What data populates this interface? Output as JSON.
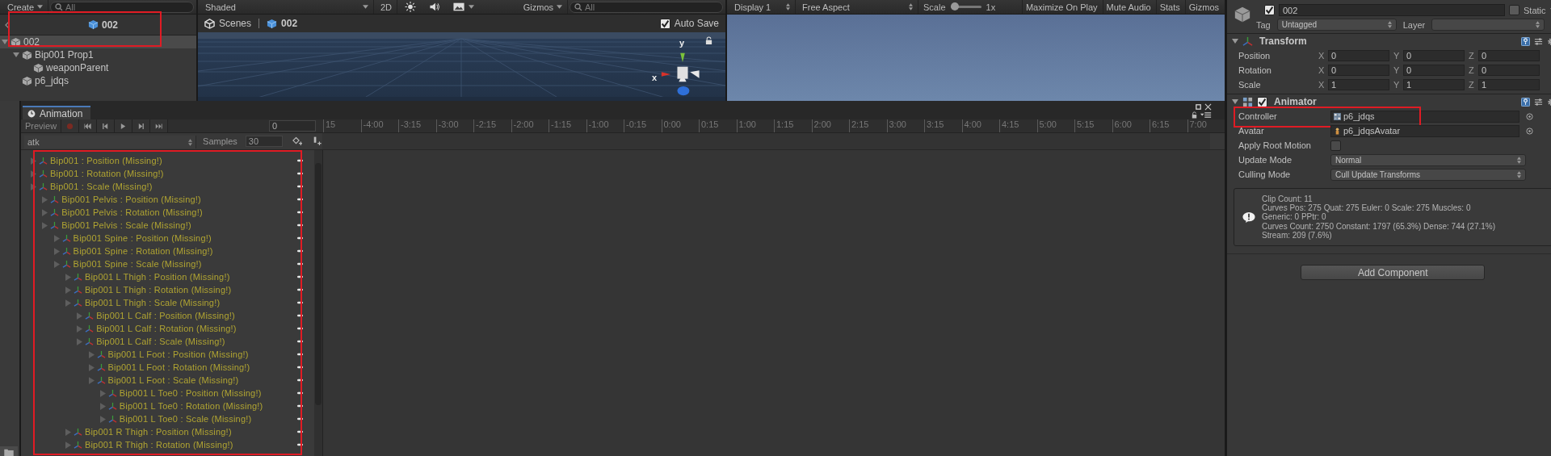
{
  "hierarchy": {
    "create": "Create",
    "search_placeholder": "All",
    "header": {
      "title": "002",
      "highlighted": true
    },
    "tree": [
      {
        "label": "002",
        "selected": true,
        "expanded": true,
        "children": [
          {
            "label": "Bip001 Prop1",
            "selected": false,
            "expanded": true,
            "children": [
              {
                "label": "weaponParent",
                "selected": false
              }
            ]
          },
          {
            "label": "p6_jdqs",
            "selected": false
          }
        ]
      }
    ]
  },
  "scene": {
    "shading": "Shaded",
    "mode_2d": "2D",
    "gizmos": "Gizmos",
    "search_placeholder": "All",
    "breadcrumb": [
      "Scenes",
      "002"
    ],
    "auto_save": {
      "label": "Auto Save",
      "checked": true
    },
    "axis_labels": [
      "y",
      "x"
    ]
  },
  "game": {
    "display": "Display 1",
    "aspect": "Free Aspect",
    "scale_label": "Scale",
    "scale": {
      "level": 0
    },
    "scale_value": "1x",
    "toggles": [
      {
        "label": "Maximize On Play",
        "on": false
      },
      {
        "label": "Mute Audio",
        "on": false
      },
      {
        "label": "Stats",
        "on": false
      },
      {
        "label": "Gizmos",
        "on": false
      }
    ]
  },
  "animation": {
    "tab": "Animation",
    "preview": "Preview",
    "recording": false,
    "frame": "0",
    "clip": "atk",
    "samples_label": "Samples",
    "samples": "30",
    "ruler": [
      "15",
      "-4:00",
      "-3:15",
      "-3:00",
      "-2:15",
      "-2:00",
      "-1:15",
      "-1:00",
      "-0:15",
      "0:00",
      "0:15",
      "1:00",
      "1:15",
      "2:00",
      "2:15",
      "3:00",
      "3:15",
      "4:00",
      "4:15",
      "5:00",
      "5:15",
      "6:00",
      "6:15",
      "7:00"
    ],
    "list_highlighted": true,
    "tracks": [
      {
        "curves": [
          "Bip001 : Position (Missing!)",
          "Bip001 : Rotation (Missing!)",
          "Bip001 : Scale (Missing!)"
        ],
        "children": [
          {
            "curves": [
              "Bip001 Pelvis : Position (Missing!)",
              "Bip001 Pelvis : Rotation (Missing!)",
              "Bip001 Pelvis : Scale (Missing!)"
            ],
            "children": [
              {
                "curves": [
                  "Bip001 Spine : Position (Missing!)",
                  "Bip001 Spine : Rotation (Missing!)",
                  "Bip001 Spine : Scale (Missing!)"
                ],
                "children": [
                  {
                    "curves": [
                      "Bip001 L Thigh : Position (Missing!)",
                      "Bip001 L Thigh : Rotation (Missing!)",
                      "Bip001 L Thigh : Scale (Missing!)"
                    ],
                    "children": [
                      {
                        "curves": [
                          "Bip001 L Calf : Position (Missing!)",
                          "Bip001 L Calf : Rotation (Missing!)",
                          "Bip001 L Calf : Scale (Missing!)"
                        ],
                        "children": [
                          {
                            "curves": [
                              "Bip001 L Foot : Position (Missing!)",
                              "Bip001 L Foot : Rotation (Missing!)",
                              "Bip001 L Foot : Scale (Missing!)"
                            ],
                            "children": [
                              {
                                "curves": [
                                  "Bip001 L Toe0 : Position (Missing!)",
                                  "Bip001 L Toe0 : Rotation (Missing!)",
                                  "Bip001 L Toe0 : Scale (Missing!)"
                                ]
                              }
                            ]
                          }
                        ]
                      }
                    ]
                  },
                  {
                    "curves": [
                      "Bip001 R Thigh : Position (Missing!)",
                      "Bip001 R Thigh : Rotation (Missing!)"
                    ]
                  }
                ]
              }
            ]
          }
        ]
      }
    ]
  },
  "inspector": {
    "object": {
      "active": true,
      "name": "002",
      "static_label": "Static",
      "static": false,
      "tag_label": "Tag",
      "tag": "Untagged",
      "layer_label": "Layer"
    },
    "transform": {
      "title": "Transform",
      "expanded": true,
      "rows": [
        {
          "label": "Position",
          "fields": [
            {
              "axis": "X",
              "value": "0"
            },
            {
              "axis": "Y",
              "value": "0"
            },
            {
              "axis": "Z",
              "value": "0"
            }
          ]
        },
        {
          "label": "Rotation",
          "fields": [
            {
              "axis": "X",
              "value": "0"
            },
            {
              "axis": "Y",
              "value": "0"
            },
            {
              "axis": "Z",
              "value": "0"
            }
          ]
        },
        {
          "label": "Scale",
          "fields": [
            {
              "axis": "X",
              "value": "1"
            },
            {
              "axis": "Y",
              "value": "1"
            },
            {
              "axis": "Z",
              "value": "1"
            }
          ]
        }
      ]
    },
    "animator": {
      "title": "Animator",
      "enabled": true,
      "expanded": true,
      "fields": [
        {
          "kind": "object",
          "label": "Controller",
          "value": "p6_jdqs",
          "highlighted": true
        },
        {
          "kind": "object",
          "label": "Avatar",
          "value": "p6_jdqsAvatar"
        },
        {
          "kind": "checkbox",
          "label": "Apply Root Motion",
          "checked": false
        },
        {
          "kind": "dropdown",
          "label": "Update Mode",
          "value": "Normal"
        },
        {
          "kind": "dropdown",
          "label": "Culling Mode",
          "value": "Cull Update Transforms"
        }
      ],
      "info": [
        "Clip Count: 11",
        "Curves Pos: 275 Quat: 275 Euler: 0 Scale: 275 Muscles: 0",
        "Generic: 0 PPtr: 0",
        "Curves Count: 2750 Constant: 1797 (65.3%) Dense: 744 (27.1%)",
        "Stream: 209 (7.6%)"
      ]
    },
    "add_component": "Add Component"
  }
}
